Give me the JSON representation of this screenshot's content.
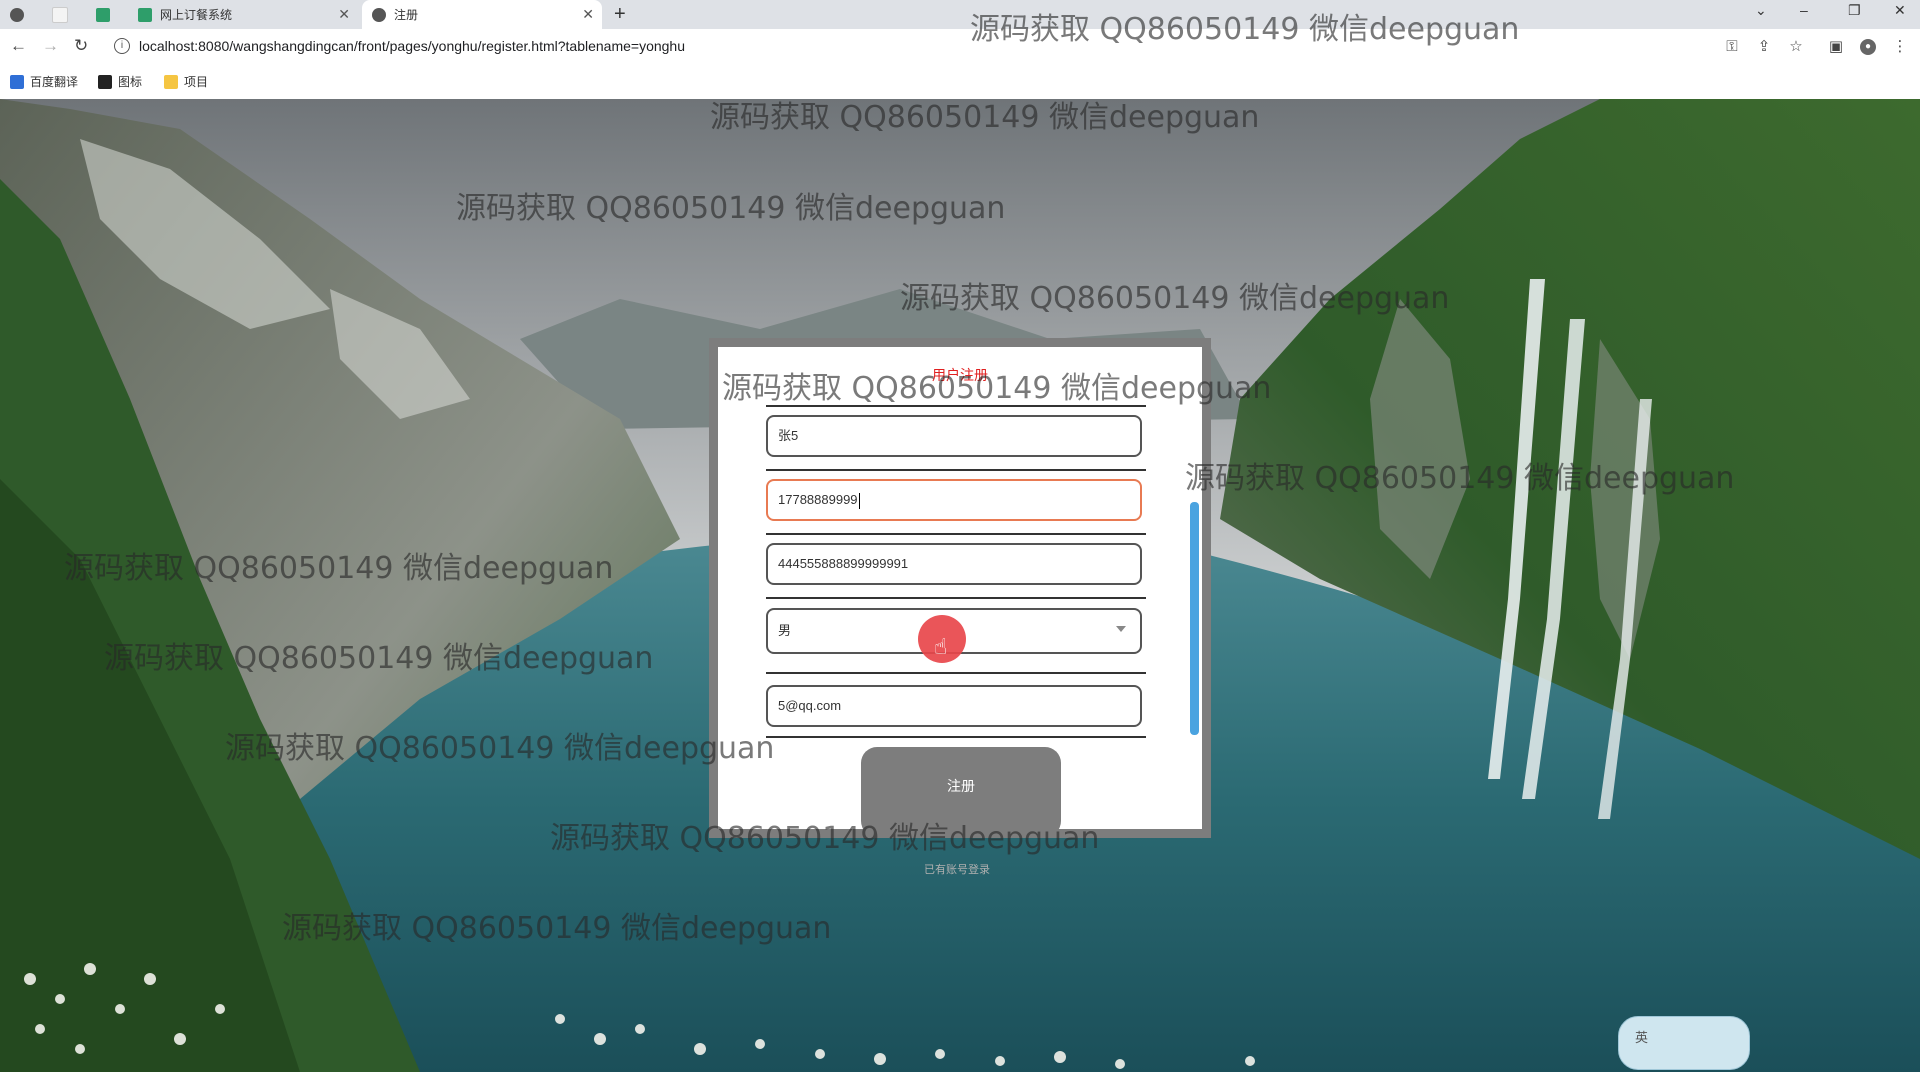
{
  "browser": {
    "tabs": [
      {
        "label": ""
      },
      {
        "label": ""
      },
      {
        "label": ""
      },
      {
        "label": "网上订餐系统"
      },
      {
        "label": "注册"
      }
    ],
    "url": "localhost:8080/wangshangdingcan/front/pages/yonghu/register.html?tablename=yonghu",
    "bookmarks": [
      {
        "label": "百度翻译"
      },
      {
        "label": "图标"
      },
      {
        "label": "项目"
      }
    ]
  },
  "form": {
    "title": "用户注册",
    "fields": [
      {
        "value": "张5"
      },
      {
        "value": "17788889999"
      },
      {
        "value": "444555888899999991"
      },
      {
        "value": "男"
      },
      {
        "value": "5@qq.com"
      }
    ],
    "submit_label": "注册",
    "login_link": "已有账号登录"
  },
  "watermark": "源码获取 QQ86050149 微信deepguan",
  "ime": {
    "label": "英"
  },
  "colors": {
    "title": "#e02020",
    "active_border": "#e87a52",
    "submit_bg": "#7d7d7d",
    "cursor_highlight": "#e8474b"
  }
}
